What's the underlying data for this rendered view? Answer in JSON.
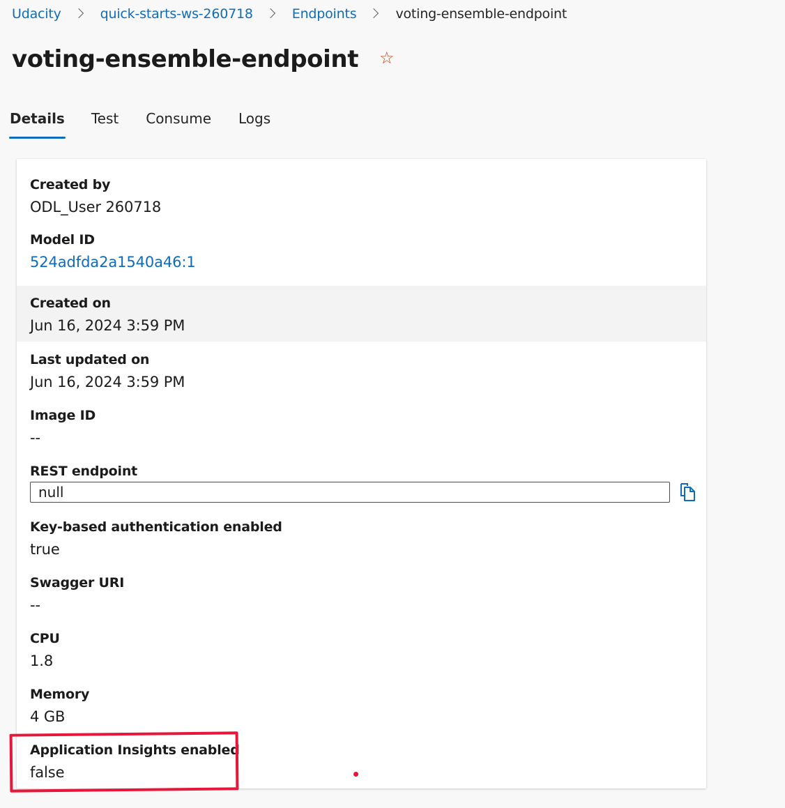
{
  "breadcrumb": {
    "items": [
      "Udacity",
      "quick-starts-ws-260718",
      "Endpoints"
    ],
    "current": "voting-ensemble-endpoint"
  },
  "page": {
    "title": "voting-ensemble-endpoint",
    "favorite_icon": "star-icon",
    "favorite_color": "#c3461b"
  },
  "tabs": [
    {
      "label": "Details",
      "active": true
    },
    {
      "label": "Test",
      "active": false
    },
    {
      "label": "Consume",
      "active": false
    },
    {
      "label": "Logs",
      "active": false
    }
  ],
  "details": {
    "created_by": {
      "label": "Created by",
      "value": "ODL_User 260718"
    },
    "model_id": {
      "label": "Model ID",
      "value": "524adfda2a1540a46:1"
    },
    "created_on": {
      "label": "Created on",
      "value": "Jun 16, 2024 3:59 PM"
    },
    "last_updated_on": {
      "label": "Last updated on",
      "value": "Jun 16, 2024 3:59 PM"
    },
    "image_id": {
      "label": "Image ID",
      "value": "--"
    },
    "rest_endpoint": {
      "label": "REST endpoint",
      "value": "null",
      "copy_icon": "copy-icon"
    },
    "key_auth": {
      "label": "Key-based authentication enabled",
      "value": "true"
    },
    "swagger_uri": {
      "label": "Swagger URI",
      "value": "--"
    },
    "cpu": {
      "label": "CPU",
      "value": "1.8"
    },
    "memory": {
      "label": "Memory",
      "value": "4 GB"
    },
    "app_insights": {
      "label": "Application Insights enabled",
      "value": "false"
    }
  },
  "colors": {
    "accent": "#0f6cbd",
    "annotation": "#e5173a"
  }
}
